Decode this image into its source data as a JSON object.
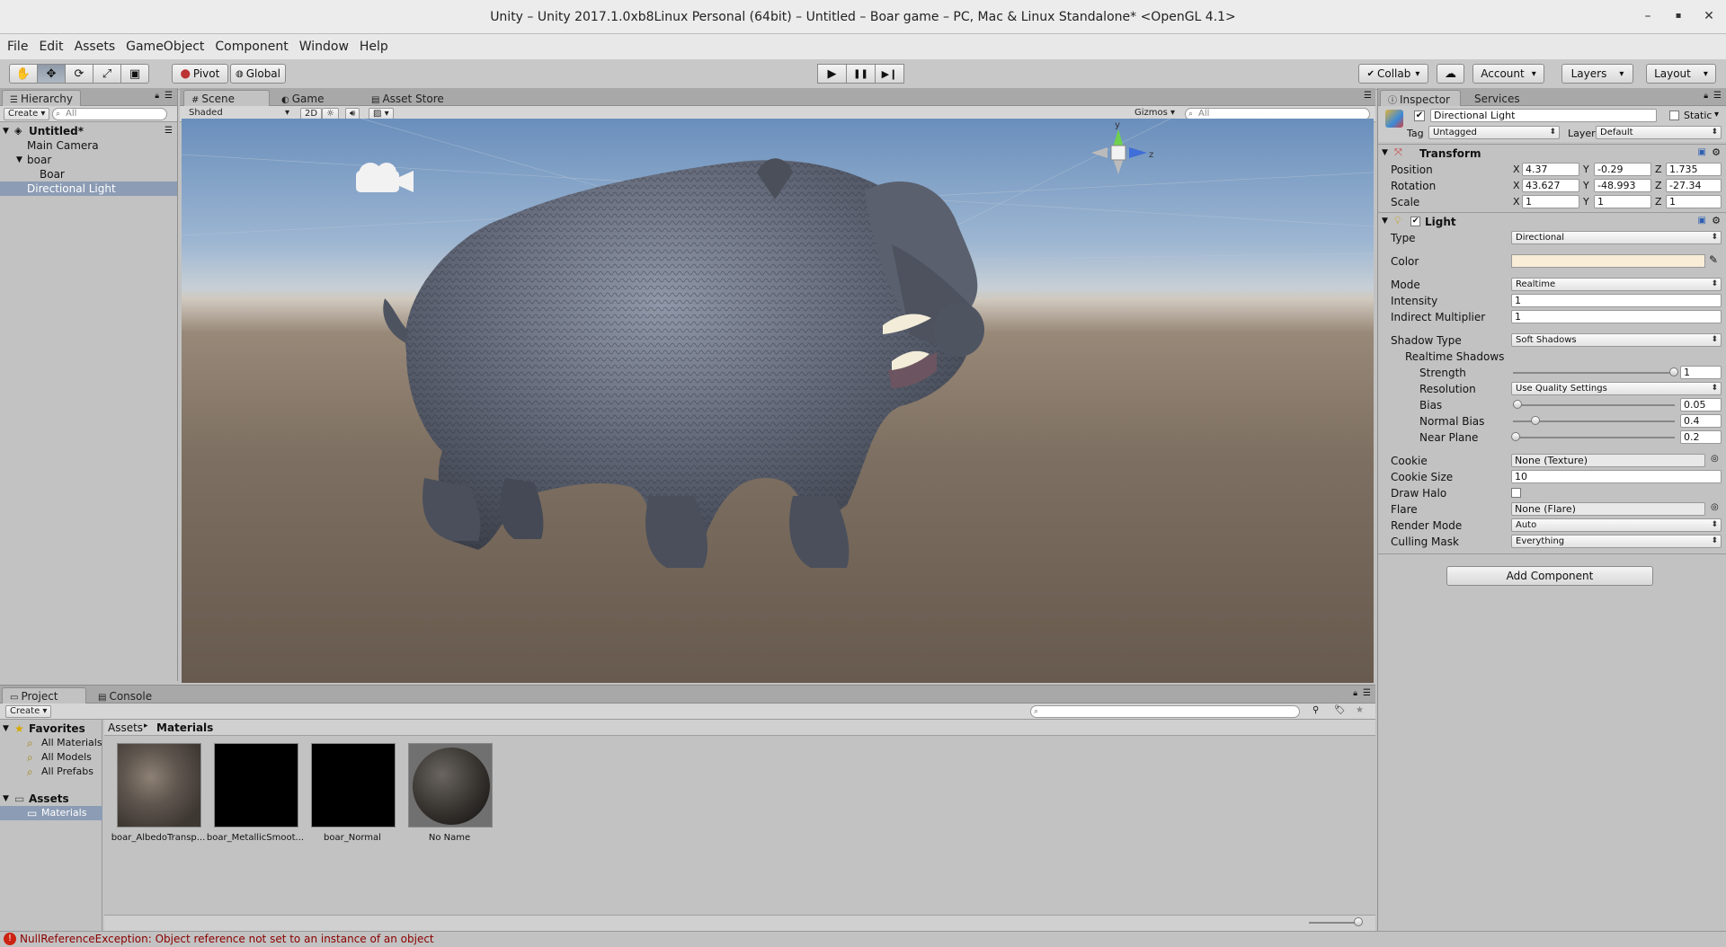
{
  "window": {
    "title": "Unity – Unity 2017.1.0xb8Linux Personal (64bit) – Untitled – Boar game – PC, Mac & Linux Standalone* <OpenGL 4.1>",
    "minimize": "–",
    "maximize": "▪",
    "close": "✕"
  },
  "menu": [
    "File",
    "Edit",
    "Assets",
    "GameObject",
    "Component",
    "Window",
    "Help"
  ],
  "toolbar": {
    "tools": [
      "hand-tool-icon",
      "move-tool-icon",
      "rotate-tool-icon",
      "scale-tool-icon",
      "rect-tool-icon"
    ],
    "pivot": "Pivot",
    "global": "Global",
    "play": "▶",
    "pause": "❚❚",
    "step": "▶❙",
    "collab": "Collab",
    "account": "Account",
    "layers": "Layers",
    "layout": "Layout"
  },
  "hierarchy": {
    "tab": "Hierarchy",
    "create": "Create",
    "search": "All",
    "scene": "Untitled*",
    "items": [
      "Main Camera",
      "boar",
      "Boar",
      "Directional Light"
    ]
  },
  "scene": {
    "tabs": [
      "Scene",
      "Game",
      "Asset Store"
    ],
    "shading": "Shaded",
    "mode2d": "2D",
    "gizmos": "Gizmos",
    "search": "All",
    "axis_y": "y",
    "axis_z": "z"
  },
  "inspector": {
    "tabs": [
      "Inspector",
      "Services"
    ],
    "object_name": "Directional Light",
    "static": "Static",
    "tag_label": "Tag",
    "tag_value": "Untagged",
    "layer_label": "Layer",
    "layer_value": "Default",
    "transform": {
      "title": "Transform",
      "position_label": "Position",
      "rotation_label": "Rotation",
      "scale_label": "Scale",
      "position": {
        "x": "4.37",
        "y": "-0.29",
        "z": "1.735"
      },
      "rotation": {
        "x": "43.627",
        "y": "-48.993",
        "z": "-27.34"
      },
      "scale": {
        "x": "1",
        "y": "1",
        "z": "1"
      }
    },
    "light": {
      "title": "Light",
      "type_label": "Type",
      "type": "Directional",
      "color_label": "Color",
      "color": "#f8edd6",
      "mode_label": "Mode",
      "mode": "Realtime",
      "intensity_label": "Intensity",
      "intensity": "1",
      "indirect_label": "Indirect Multiplier",
      "indirect": "1",
      "shadow_type_label": "Shadow Type",
      "shadow_type": "Soft Shadows",
      "realtime_shadows_label": "Realtime Shadows",
      "strength_label": "Strength",
      "strength": "1",
      "strength_frac": 1.0,
      "resolution_label": "Resolution",
      "resolution": "Use Quality Settings",
      "bias_label": "Bias",
      "bias": "0.05",
      "bias_frac": 0.0,
      "normal_bias_label": "Normal Bias",
      "normal_bias": "0.4",
      "normal_bias_frac": 0.12,
      "near_plane_label": "Near Plane",
      "near_plane": "0.2",
      "near_plane_frac": 0.0,
      "cookie_label": "Cookie",
      "cookie": "None (Texture)",
      "cookie_size_label": "Cookie Size",
      "cookie_size": "10",
      "draw_halo_label": "Draw Halo",
      "flare_label": "Flare",
      "flare": "None (Flare)",
      "render_mode_label": "Render Mode",
      "render_mode": "Auto",
      "culling_mask_label": "Culling Mask",
      "culling_mask": "Everything"
    },
    "add_component": "Add Component"
  },
  "project": {
    "tabs": [
      "Project",
      "Console"
    ],
    "create": "Create",
    "favorites_label": "Favorites",
    "favorites": [
      "All Materials",
      "All Models",
      "All Prefabs"
    ],
    "assets_label": "Assets",
    "folders": [
      "Materials"
    ],
    "breadcrumb": [
      "Assets",
      "Materials"
    ],
    "assets": [
      {
        "name": "boar_AlbedoTransp...",
        "kind": "texture"
      },
      {
        "name": "boar_MetallicSmoot...",
        "kind": "black"
      },
      {
        "name": "boar_Normal",
        "kind": "black"
      },
      {
        "name": "No Name",
        "kind": "sphere"
      }
    ]
  },
  "status": {
    "message": "NullReferenceException: Object reference not set to an instance of an object"
  }
}
